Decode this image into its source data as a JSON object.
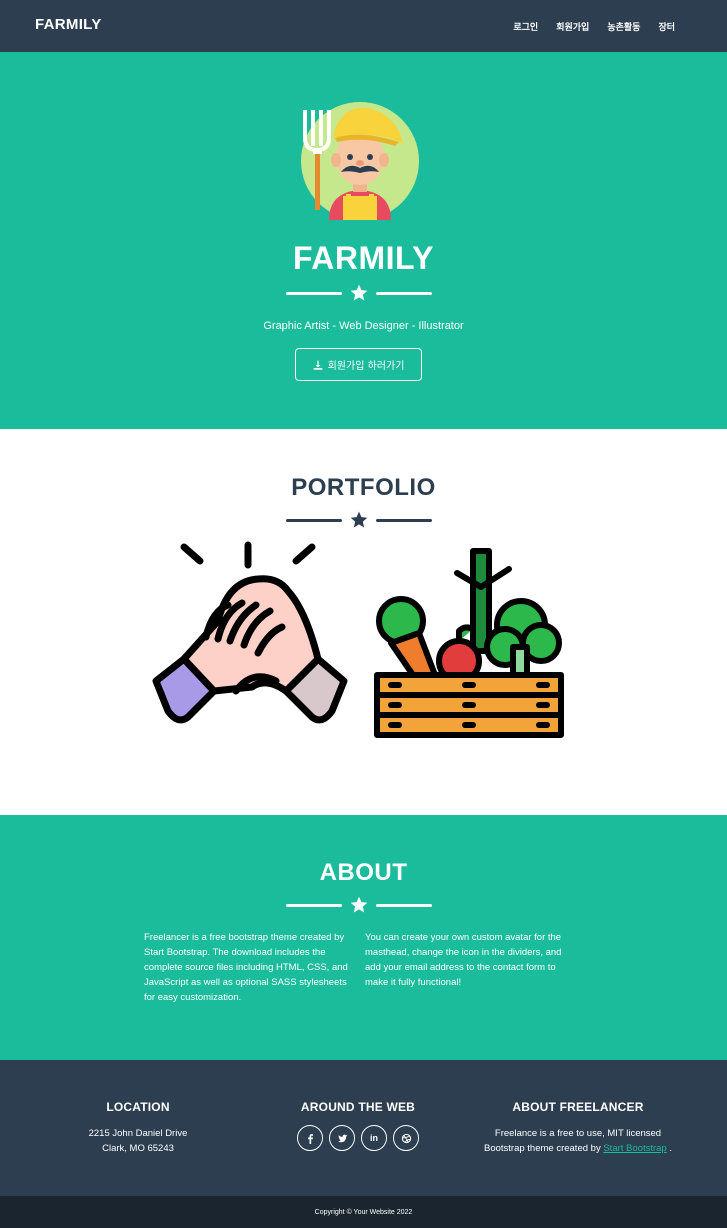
{
  "navbar": {
    "brand": "FARMILY",
    "links": [
      "로그인",
      "회원가입",
      "농촌활동",
      "장터"
    ]
  },
  "masthead": {
    "avatar_icon": "farmer-avatar-icon",
    "title": "FARMILY",
    "subtitle": "Graphic Artist - Web Designer - Illustrator",
    "button_label": "회원가입 하러가기",
    "button_icon": "download-icon"
  },
  "portfolio": {
    "title": "PORTFOLIO",
    "items": [
      {
        "icon": "handshake-icon"
      },
      {
        "icon": "vegetable-crate-icon"
      }
    ]
  },
  "about": {
    "title": "ABOUT",
    "left_text": "Freelancer is a free bootstrap theme created by Start Bootstrap. The download includes the complete source files including HTML, CSS, and JavaScript as well as optional SASS stylesheets for easy customization.",
    "right_text": "You can create your own custom avatar for the masthead, change the icon in the dividers, and add your email address to the contact form to make it fully functional!"
  },
  "footer": {
    "location": {
      "heading": "LOCATION",
      "line1": "2215 John Daniel Drive",
      "line2": "Clark, MO 65243"
    },
    "around": {
      "heading": "AROUND THE WEB",
      "socials": [
        "facebook-icon",
        "twitter-icon",
        "linkedin-icon",
        "dribbble-icon"
      ]
    },
    "about_freelancer": {
      "heading": "ABOUT FREELANCER",
      "line1": "Freelance is a free to use, MIT licensed",
      "line2_prefix": "Bootstrap theme created by",
      "link_text": "Start Bootstrap",
      "line2_suffix": "."
    }
  },
  "copyright": "Copyright © Your Website 2022",
  "colors": {
    "primary": "#1abc9c",
    "secondary": "#2c3e50",
    "dark": "#1a252f"
  }
}
